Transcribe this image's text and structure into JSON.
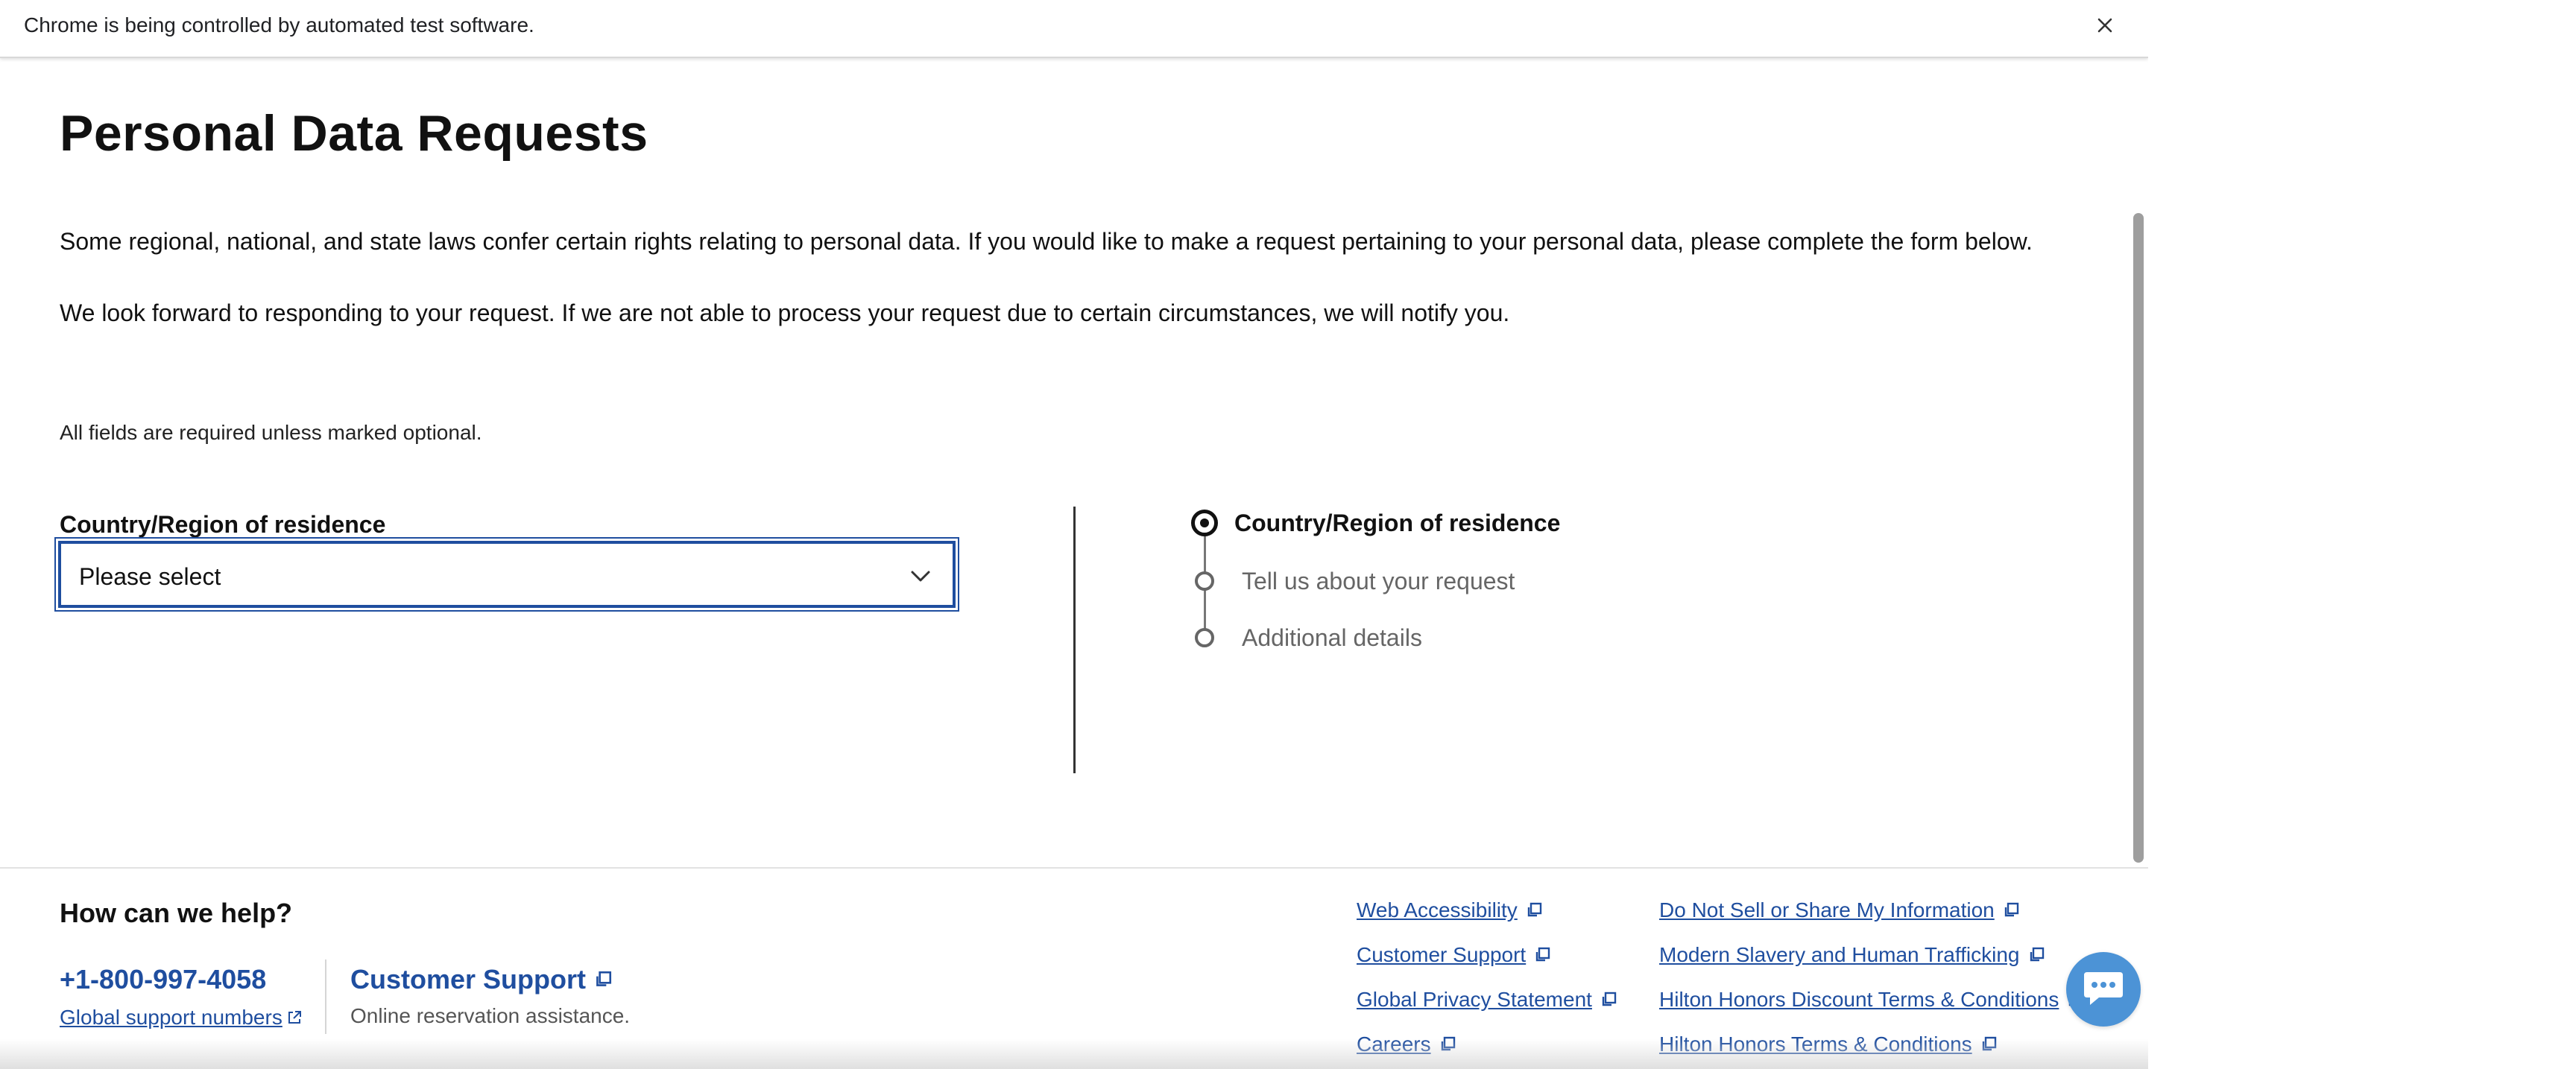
{
  "infobar": {
    "message": "Chrome is being controlled by automated test software.",
    "close_icon": "close-icon"
  },
  "page": {
    "title": "Personal Data Requests",
    "intro_1": "Some regional, national, and state laws confer certain rights relating to personal data. If you would like to make a request pertaining to your personal data, please complete the form below.",
    "intro_2": "We look forward to responding to your request. If we are not able to process your request due to certain circumstances, we will notify you.",
    "required_note": "All fields are required unless marked optional."
  },
  "form": {
    "country_label": "Country/Region of residence",
    "country_value": "Please select"
  },
  "stepper": {
    "steps": [
      {
        "label": "Country/Region of residence",
        "state": "active"
      },
      {
        "label": "Tell us about your request",
        "state": "pending"
      },
      {
        "label": "Additional details",
        "state": "pending"
      }
    ]
  },
  "footer": {
    "help_title": "How can we help?",
    "phone": "+1-800-997-4058",
    "global_support": "Global support numbers",
    "support_title": "Customer Support",
    "support_sub": "Online reservation assistance.",
    "links_col1": [
      "Web Accessibility",
      "Customer Support",
      "Global Privacy Statement",
      "Careers"
    ],
    "links_col2": [
      "Do Not Sell or Share My Information",
      "Modern Slavery and Human Trafficking",
      "Hilton Honors Discount Terms & Conditions",
      "Hilton Honors Terms & Conditions"
    ]
  },
  "chat": {
    "icon": "chat-bubble-icon"
  },
  "colors": {
    "link_blue": "#1f4e9f",
    "chat_blue": "#4c93d6",
    "text_dark": "#111111",
    "text_muted": "#666666"
  }
}
